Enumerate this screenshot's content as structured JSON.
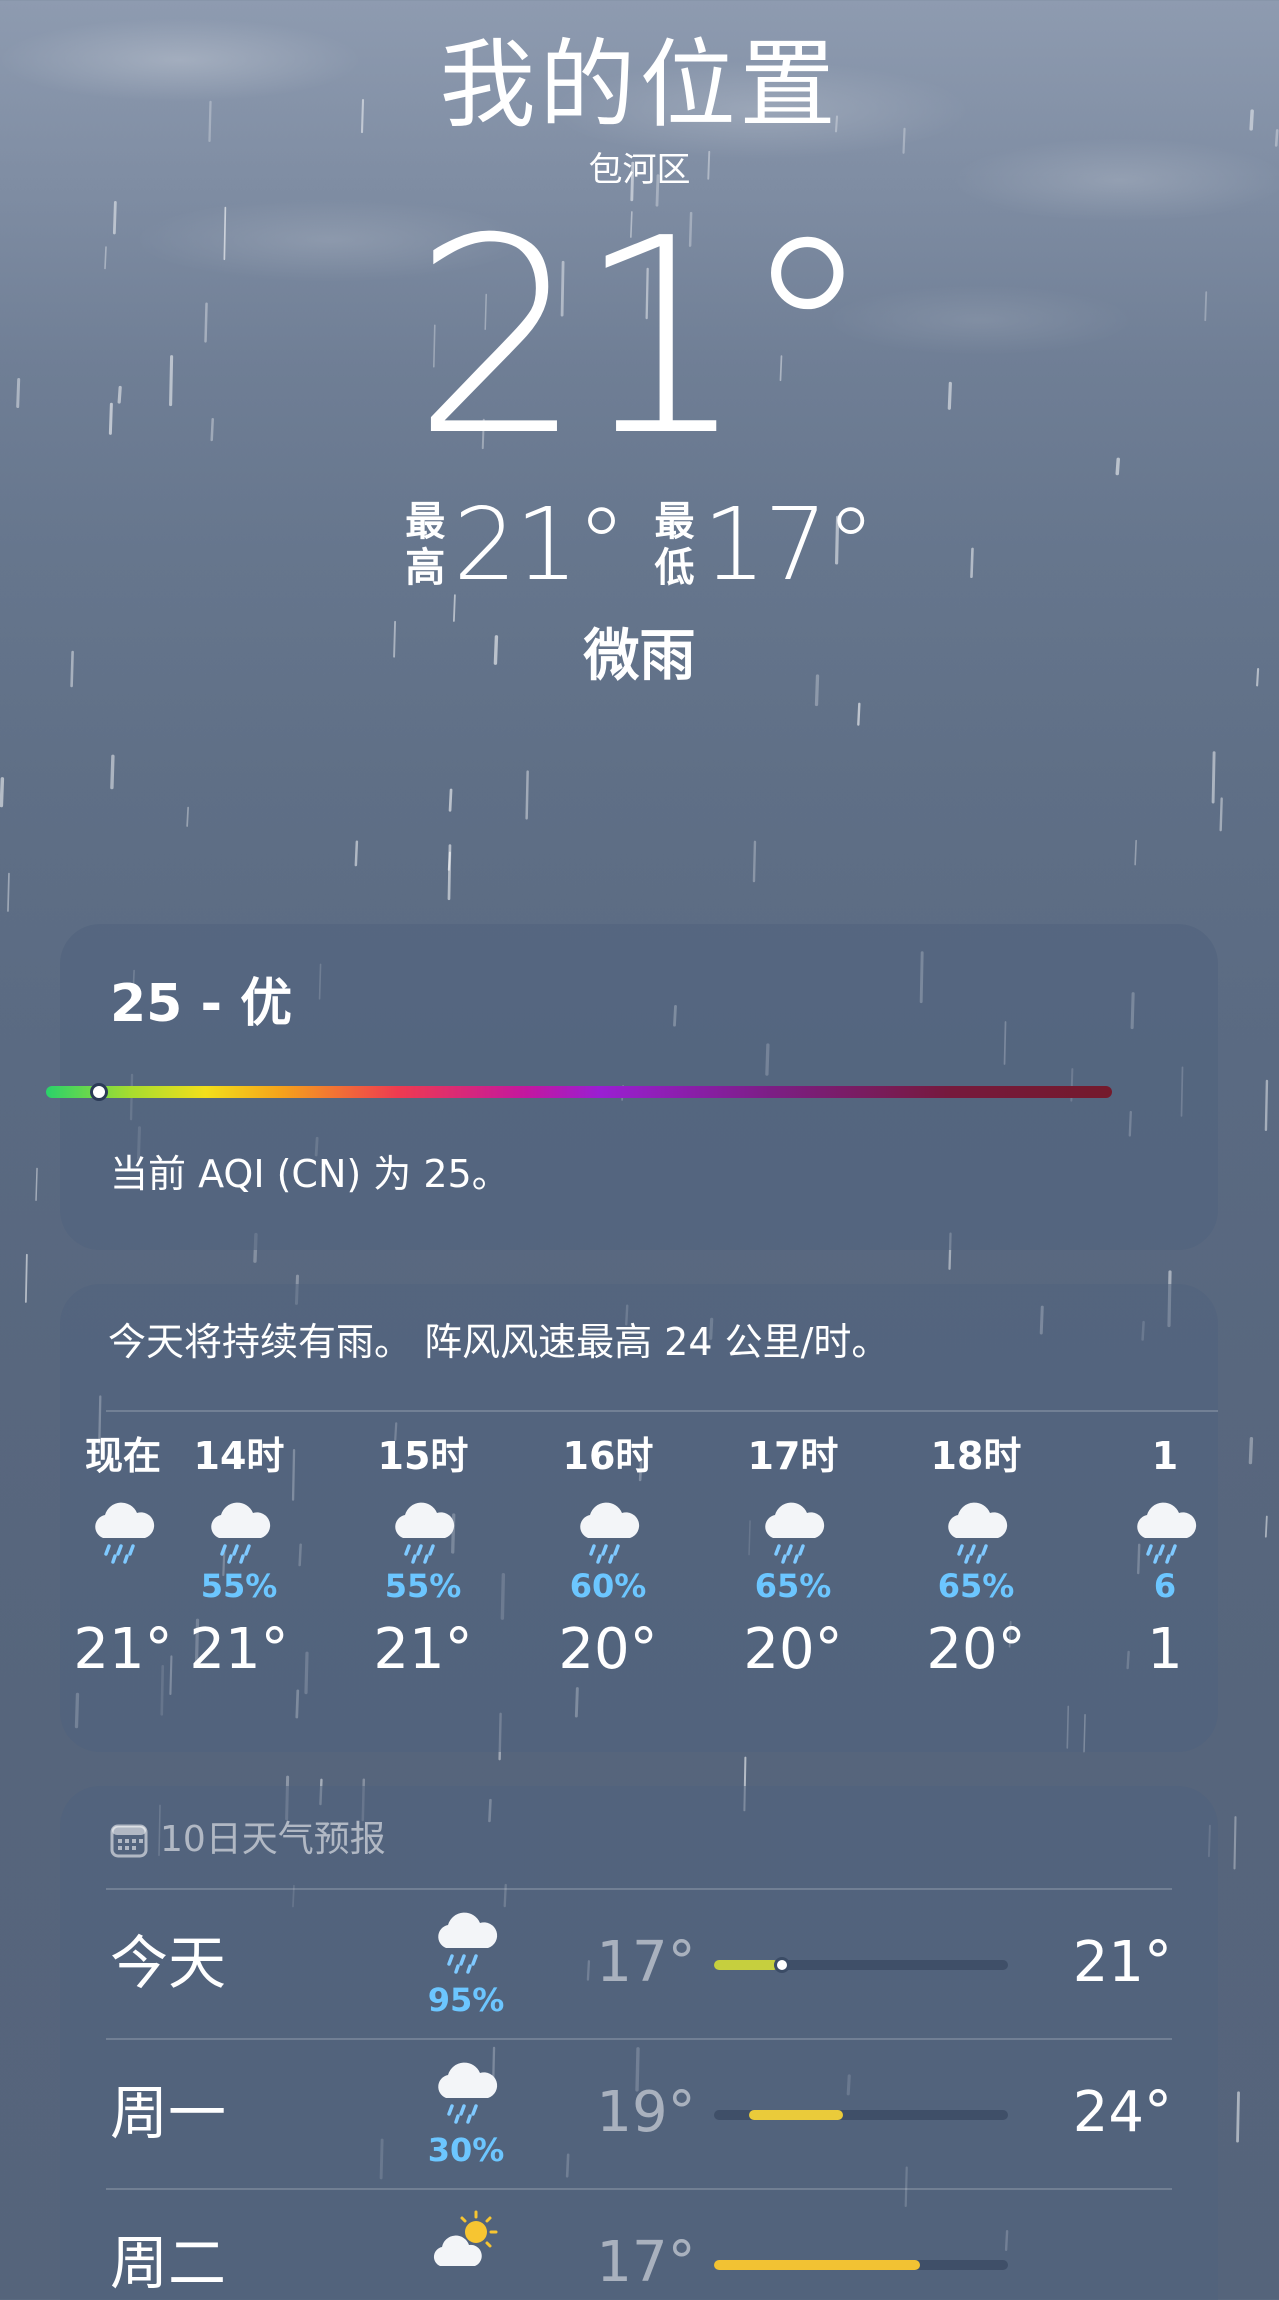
{
  "header": {
    "title": "我的位置",
    "district": "包河区",
    "current_temp": "21°",
    "high_label_1": "最",
    "high_label_2": "高",
    "high_value": "21°",
    "low_label_1": "最",
    "low_label_2": "低",
    "low_value": "17°",
    "condition": "微雨"
  },
  "aqi": {
    "value_text": "25 - 优",
    "aqi_value": 25,
    "description": "当前 AQI (CN) 为 25。"
  },
  "hourly": {
    "summary": "今天将持续有雨。 阵风风速最高 24 公里/时。",
    "items": [
      {
        "label": "现在",
        "pop": "",
        "temp": "21°",
        "icon": "cloud-rain-icon"
      },
      {
        "label": "14时",
        "pop": "55%",
        "temp": "21°",
        "icon": "cloud-rain-icon"
      },
      {
        "label": "15时",
        "pop": "55%",
        "temp": "21°",
        "icon": "cloud-rain-icon"
      },
      {
        "label": "16时",
        "pop": "60%",
        "temp": "20°",
        "icon": "cloud-rain-icon"
      },
      {
        "label": "17时",
        "pop": "65%",
        "temp": "20°",
        "icon": "cloud-rain-icon"
      },
      {
        "label": "18时",
        "pop": "65%",
        "temp": "20°",
        "icon": "cloud-rain-icon"
      },
      {
        "label": "1",
        "pop": "6",
        "temp": "1",
        "icon": "cloud-rain-icon"
      }
    ]
  },
  "forecast": {
    "title": "10日天气预报",
    "days": [
      {
        "name": "今天",
        "pop": "95%",
        "low": "17°",
        "high": "21°",
        "icon": "cloud-rain-icon",
        "fill_start": 0.0,
        "fill_end": 0.22,
        "fill_color": "#c6cf3e",
        "current": 0.23
      },
      {
        "name": "周一",
        "pop": "30%",
        "low": "19°",
        "high": "24°",
        "icon": "cloud-rain-icon",
        "fill_start": 0.12,
        "fill_end": 0.44,
        "fill_color": "#eacb3a",
        "current": null
      },
      {
        "name": "周二",
        "pop": "",
        "low": "17°",
        "high": "",
        "icon": "sun-cloud-icon",
        "fill_start": 0.0,
        "fill_end": 0.7,
        "fill_color": "#f2c233",
        "current": null
      }
    ]
  },
  "colors": {
    "accent_blue": "#6cc6ff",
    "card_bg": "rgba(80,98,126,0.55)"
  }
}
